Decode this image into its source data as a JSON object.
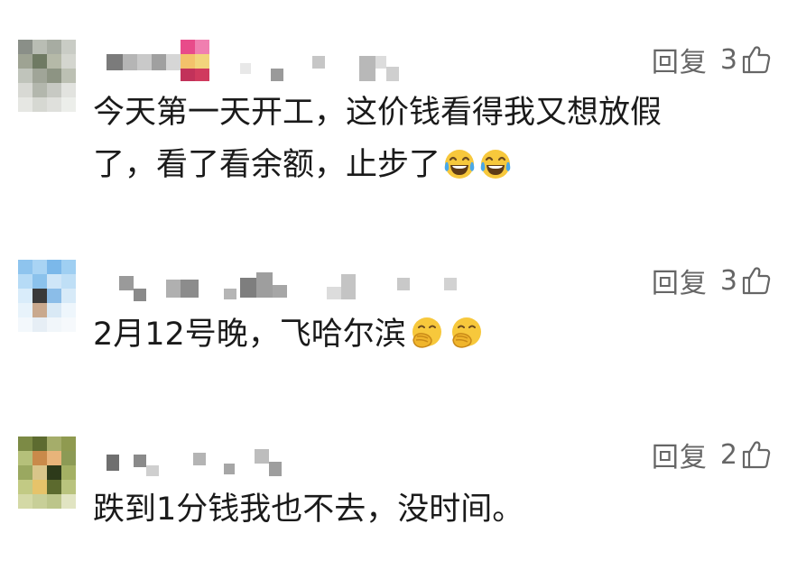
{
  "comments": [
    {
      "reply_label": "回复",
      "like_count": "3",
      "text_line1": "今天第一天开工，这价钱看得我又想放假",
      "text_line2": "了，看了看余额，止步了",
      "emoji": "tears-of-joy-emoji",
      "emoji_count": 2
    },
    {
      "reply_label": "回复",
      "like_count": "3",
      "text_line1": "2月12号晚，飞哈尔滨",
      "emoji": "hand-over-mouth-emoji",
      "emoji_count": 2
    },
    {
      "reply_label": "回复",
      "like_count": "2",
      "text_line1": "跌到1分钱我也不去，没时间。"
    }
  ],
  "colors": {
    "text": "#1a1a1a",
    "meta": "#666666",
    "background": "#ffffff"
  },
  "icons": {
    "like": "thumbs-up-outline-icon"
  }
}
